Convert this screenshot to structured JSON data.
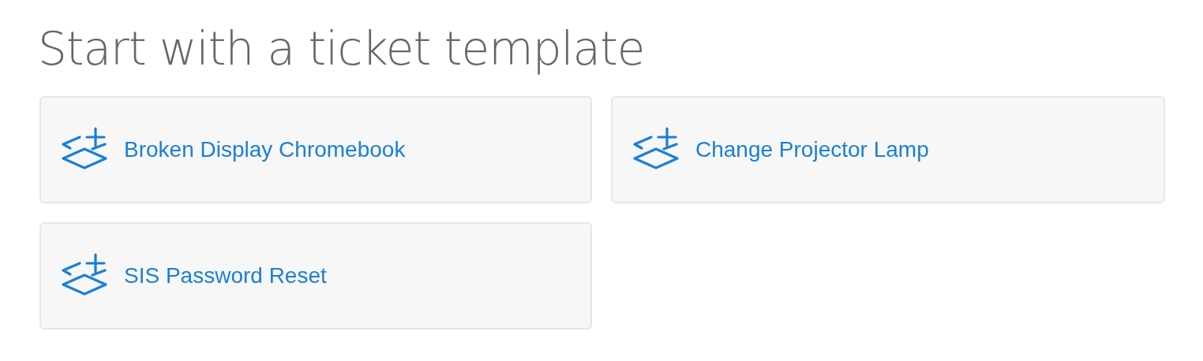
{
  "title": "Start with a ticket template",
  "templates": [
    {
      "label": "Broken Display Chromebook"
    },
    {
      "label": "Change Projector Lamp"
    },
    {
      "label": "SIS Password Reset"
    }
  ]
}
